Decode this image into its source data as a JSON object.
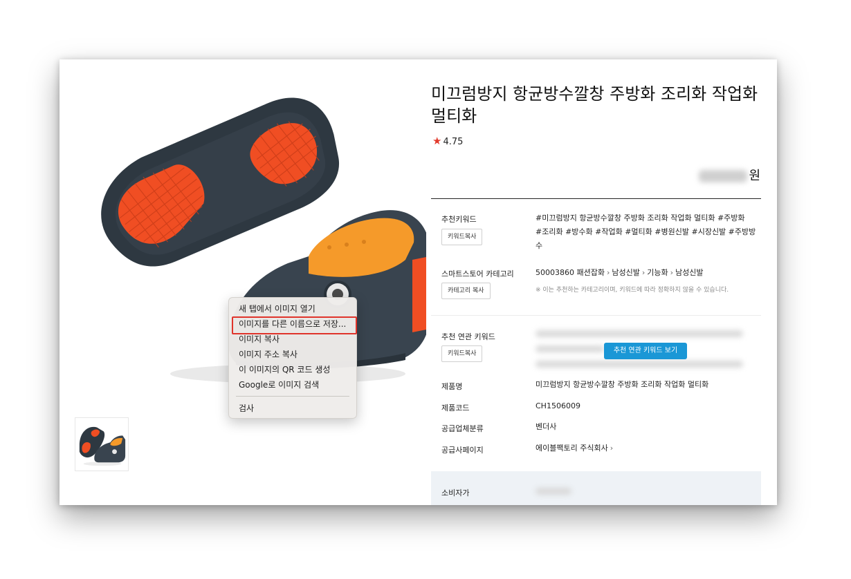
{
  "product": {
    "title": "미끄럼방지 항균방수깔창 주방화 조리화 작업화 멀티화",
    "rating": "4.75",
    "price_unit": "원"
  },
  "context_menu": {
    "items": [
      "새 탭에서 이미지 열기",
      "이미지를 다른 이름으로 저장...",
      "이미지 복사",
      "이미지 주소 복사",
      "이 이미지의 QR 코드 생성",
      "Google로 이미지 검색"
    ],
    "inspect": "검사",
    "highlight_color": "#e0332a"
  },
  "details": {
    "keywords_label": "추천키워드",
    "keywords_value_line1": "#미끄럼방지 항균방수깔창 주방화 조리화 작업화 멀티화 #주방화",
    "keywords_value_line2": "#조리화 #방수화 #작업화 #멀티화 #병원신발 #시장신발 #주방방",
    "keywords_value_line3": "수",
    "keywords_copy_button": "키워드복사",
    "category_label": "스마트스토어 카테고리",
    "category_id": "50003860",
    "category_path": [
      "패션잡화",
      "남성신발",
      "기능화",
      "남성신발"
    ],
    "category_note": "※ 이는 추천하는 카테고리이며, 키워드에 따라 정확하지 않을 수 있습니다.",
    "category_copy_button": "카테고리 복사",
    "related_label": "추천 연관 키워드",
    "related_copy_button": "키워드복사",
    "related_view_button": "추천 연관 키워드 보기",
    "name_label": "제품명",
    "name_value": "미끄럼방지 항균방수깔창 주방화 조리화 작업화 멀티화",
    "code_label": "제품코드",
    "code_value": "CH1506009",
    "supplier_type_label": "공급업체분류",
    "supplier_type_value": "벤더사",
    "supplier_page_label": "공급사페이지",
    "supplier_page_value": "에이블팩토리 주식회사",
    "consumer_price_label": "소비자가"
  },
  "colors": {
    "shoe_body": "#39444f",
    "sole_orange": "#f04e23",
    "insole_orange": "#f59a2a",
    "accent_blue": "#1a97d6",
    "star_red": "#e23a2c"
  }
}
